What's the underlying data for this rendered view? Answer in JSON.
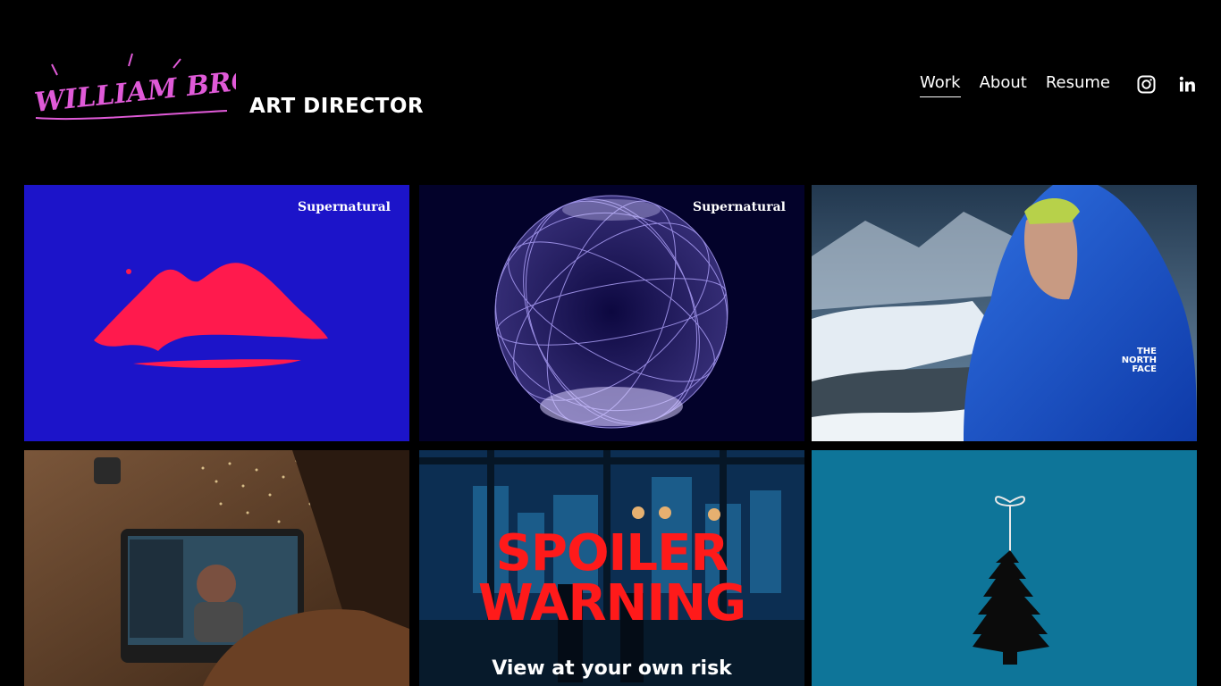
{
  "header": {
    "logo_text": "WILLIAM BROUSSARD",
    "tagline": "ART DIRECTOR"
  },
  "nav": {
    "items": [
      {
        "label": "Work",
        "active": true
      },
      {
        "label": "About",
        "active": false
      },
      {
        "label": "Resume",
        "active": false
      }
    ],
    "social": [
      "instagram-icon",
      "linkedin-icon"
    ]
  },
  "grid": {
    "tiles": [
      {
        "brand": "Supernatural"
      },
      {
        "brand": "Supernatural"
      },
      {
        "brand_mark": "THE NORTH FACE"
      },
      {},
      {
        "headline_1": "SPOILER",
        "headline_2": "WARNING",
        "caption": "View at your own risk"
      },
      {}
    ]
  },
  "colors": {
    "background": "#000000",
    "logo_pink": "#e05ad8",
    "tile1_bg": "#1c14c9",
    "tile1_shape": "#ff1a4d",
    "tile6_bg": "#0e7599",
    "spoiler_red": "#ff1a1a"
  }
}
